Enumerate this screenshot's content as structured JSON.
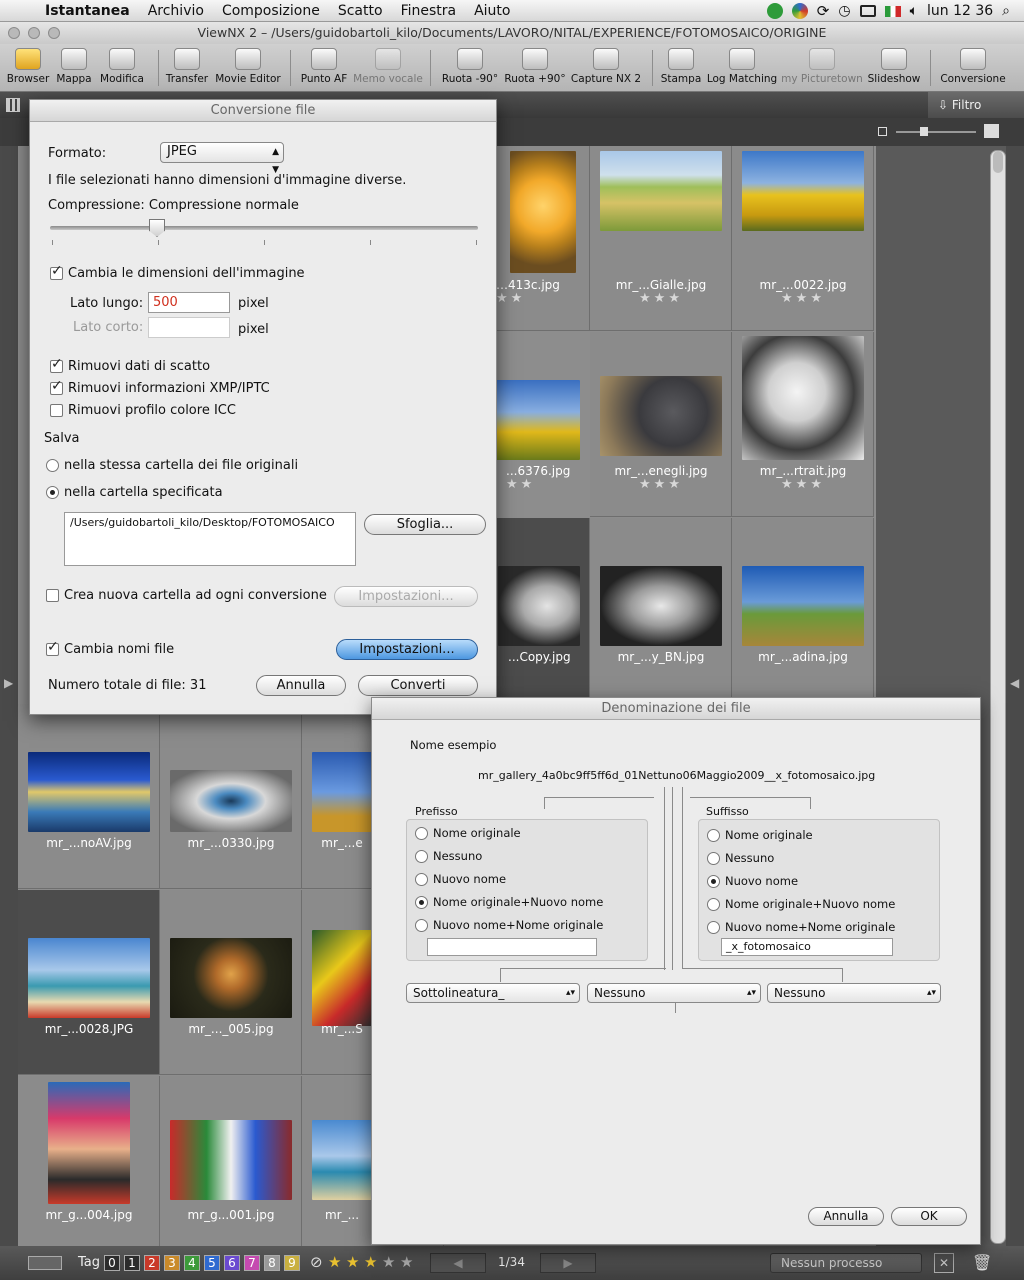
{
  "menubar": {
    "app": "Istantanea",
    "items": [
      "Archivio",
      "Composizione",
      "Scatto",
      "Finestra",
      "Aiuto"
    ],
    "clock": "lun 12 36"
  },
  "window": {
    "title": "ViewNX 2 – /Users/guidobartoli_kilo/Documents/LAVORO/NITAL/EXPERIENCE/FOTOMOSAICO/ORIGINE"
  },
  "toolbar": {
    "browser": "Browser",
    "mappa": "Mappa",
    "modifica": "Modifica",
    "transfer": "Transfer",
    "movie_editor": "Movie Editor",
    "punto_af": "Punto AF",
    "memo_vocale": "Memo vocale",
    "ruota_sx": "Ruota -90°",
    "ruota_dx": "Ruota +90°",
    "capture_nx": "Capture NX 2",
    "stampa": "Stampa",
    "log_matching": "Log Matching",
    "my_picturetown": "my Picturetown",
    "slideshow": "Slideshow",
    "conversione": "Conversione",
    "filtro": "Filtro"
  },
  "thumbnails": [
    {
      "caption": "…413c.jpg",
      "stars": "★★"
    },
    {
      "caption": "mr_...Gialle.jpg",
      "stars": "★★★"
    },
    {
      "caption": "mr_...0022.jpg",
      "stars": "★★★"
    },
    {
      "caption": "...6376.jpg",
      "stars": "★★"
    },
    {
      "caption": "mr_...enegli.jpg",
      "stars": "★★★"
    },
    {
      "caption": "mr_...rtrait.jpg",
      "stars": "★★★"
    },
    {
      "caption": "...Copy.jpg",
      "stars": ""
    },
    {
      "caption": "mr_...y_BN.jpg",
      "stars": ""
    },
    {
      "caption": "mr_...adina.jpg",
      "stars": ""
    },
    {
      "caption": "mr_...noAV.jpg",
      "stars": ""
    },
    {
      "caption": "mr_...0330.jpg",
      "stars": ""
    },
    {
      "caption": "mr_...e",
      "stars": ""
    },
    {
      "caption": "mr_...0028.JPG",
      "stars": ""
    },
    {
      "caption": "mr_..._005.jpg",
      "stars": ""
    },
    {
      "caption": "mr_...S",
      "stars": ""
    },
    {
      "caption": "mr_g...004.jpg",
      "stars": ""
    },
    {
      "caption": "mr_g...001.jpg",
      "stars": ""
    },
    {
      "caption": "mr_...",
      "stars": ""
    }
  ],
  "bottombar": {
    "tag_label": "Tag",
    "tags": [
      "0",
      "1",
      "2",
      "3",
      "4",
      "5",
      "6",
      "7",
      "8",
      "9"
    ],
    "tag_colors": [
      "#2c2c2c",
      "#2c2c2c",
      "#c93a2a",
      "#c98a2a",
      "#3c9a3a",
      "#2f6ad0",
      "#6a4ad0",
      "#c54ab0",
      "#999999",
      "#c9b040"
    ],
    "page": "1/34",
    "process": "Nessun processo"
  },
  "conversione": {
    "title": "Conversione file",
    "formato_label": "Formato:",
    "formato_value": "JPEG",
    "info": "I file selezionati hanno dimensioni d'immagine diverse.",
    "compressione": "Compressione: Compressione normale",
    "compression_level": 0.25,
    "cambia_dimensioni": "Cambia le dimensioni dell'immagine",
    "lato_lungo_label": "Lato lungo:",
    "lato_lungo_value": "500",
    "lato_corto_label": "Lato corto:",
    "pixel": "pixel",
    "rimuovi_scatto": "Rimuovi dati di scatto",
    "rimuovi_xmp": "Rimuovi informazioni XMP/IPTC",
    "rimuovi_icc": "Rimuovi profilo colore ICC",
    "salva_label": "Salva",
    "salva_stessa": "nella stessa cartella dei file originali",
    "salva_specificata": "nella cartella specificata",
    "percorso": "/Users/guidobartoli_kilo/Desktop/FOTOMOSAICO",
    "sfoglia": "Sfoglia...",
    "crea_cartella": "Crea nuova cartella ad ogni conversione",
    "impostazioni": "Impostazioni...",
    "cambia_nomi": "Cambia nomi file",
    "totale": "Numero totale di file: 31",
    "annulla": "Annulla",
    "converti": "Converti"
  },
  "denominazione": {
    "title": "Denominazione dei file",
    "nome_esempio_label": "Nome esempio",
    "nome_esempio": "mr_gallery_4a0bc9ff5ff6d_01Nettuno06Maggio2009__x_fotomosaico.jpg",
    "prefisso_label": "Prefisso",
    "suffisso_label": "Suffisso",
    "options": [
      "Nome originale",
      "Nessuno",
      "Nuovo nome",
      "Nome originale+Nuovo nome",
      "Nuovo nome+Nome originale"
    ],
    "prefisso_selected": 3,
    "suffisso_selected": 2,
    "prefisso_text": "",
    "suffisso_text": "_x_fotomosaico",
    "separatore1": "Sottolineatura_",
    "separatore2": "Nessuno",
    "separatore3": "Nessuno",
    "annulla": "Annulla",
    "ok": "OK"
  }
}
